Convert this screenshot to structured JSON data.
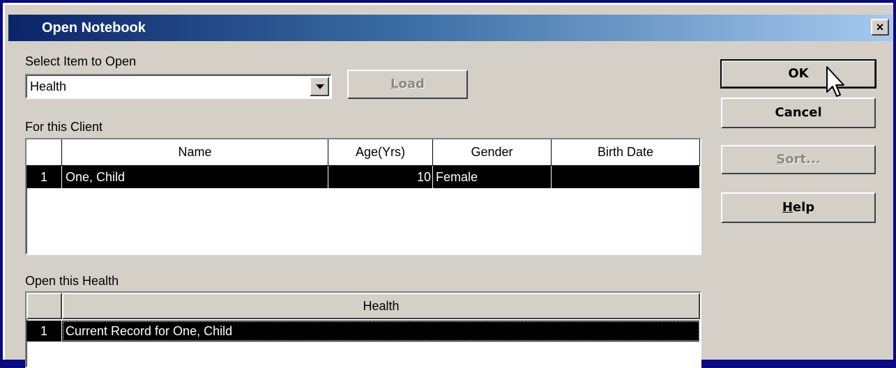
{
  "window": {
    "title": "Open Notebook",
    "close_glyph": "×"
  },
  "select_item": {
    "label": "Select Item to Open",
    "value": "Health"
  },
  "buttons": {
    "load": {
      "pre": "",
      "accel": "L",
      "post": "oad"
    },
    "ok": "OK",
    "cancel": "Cancel",
    "sort": {
      "accel": "S",
      "post": "ort..."
    },
    "help": {
      "accel": "H",
      "post": "elp"
    }
  },
  "client_section": {
    "label": "For this Client",
    "columns": [
      "",
      "Name",
      "Age(Yrs)",
      "Gender",
      "Birth Date"
    ],
    "rows": [
      {
        "index": "1",
        "name": "One, Child",
        "age": "10",
        "gender": "Female",
        "birth_date": ""
      }
    ]
  },
  "health_section": {
    "label": "Open this Health",
    "columns": [
      "",
      "Health"
    ],
    "rows": [
      {
        "index": "1",
        "record": "Current Record for One, Child"
      }
    ]
  },
  "icons": {
    "cursor": "arrow-cursor-icon",
    "dropdown": "chevron-down-icon",
    "close": "close-icon"
  },
  "colors": {
    "titlebar_start": "#0a246a",
    "titlebar_end": "#a6caf0",
    "face": "#d4d0c8",
    "selection": "#000000"
  }
}
